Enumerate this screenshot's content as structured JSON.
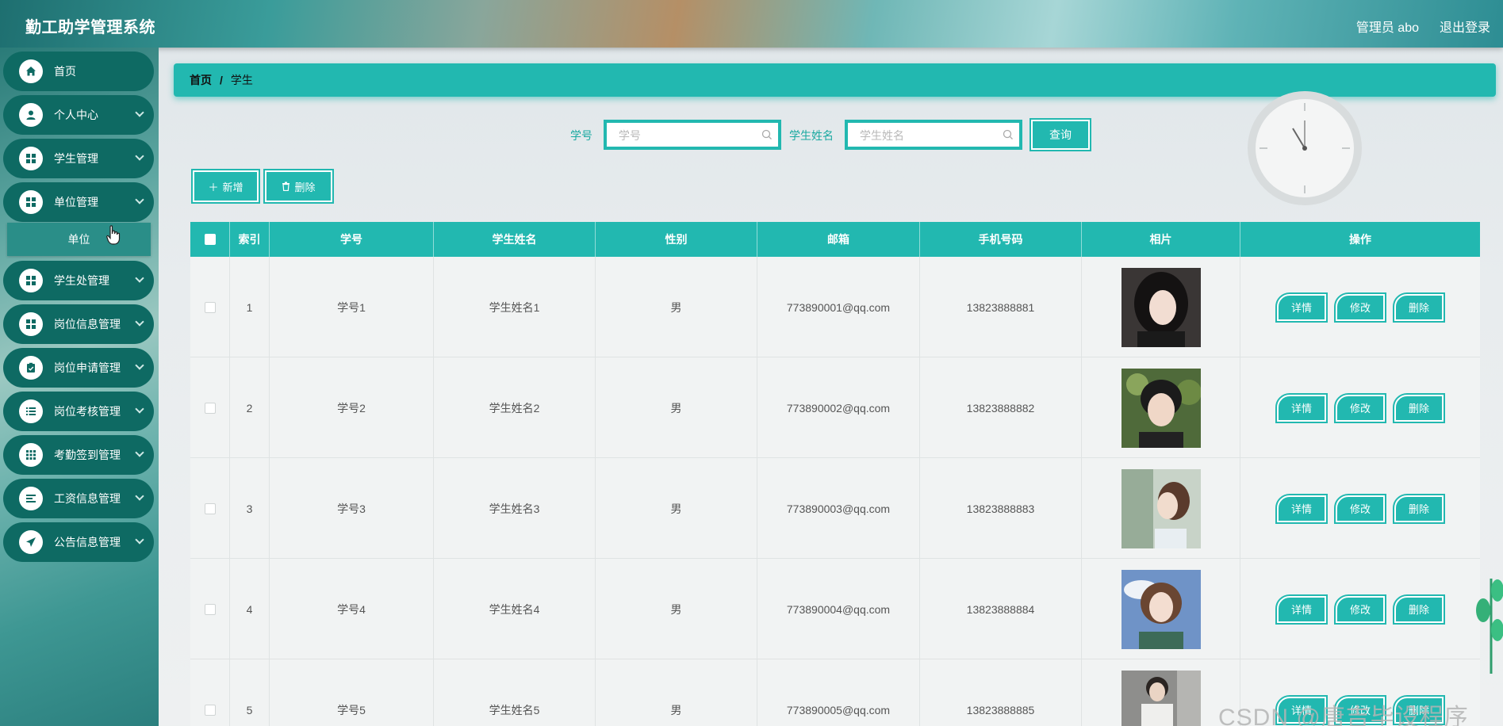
{
  "app": {
    "title": "勤工助学管理系统"
  },
  "header": {
    "user_label": "管理员 abo",
    "logout_label": "退出登录"
  },
  "sidebar": {
    "items": [
      {
        "label": "首页",
        "icon": "home-icon",
        "has_arrow": false
      },
      {
        "label": "个人中心",
        "icon": "user-icon",
        "has_arrow": true
      },
      {
        "label": "学生管理",
        "icon": "grid-icon",
        "has_arrow": true
      },
      {
        "label": "单位管理",
        "icon": "grid-icon",
        "has_arrow": true
      },
      {
        "label": "学生处管理",
        "icon": "grid-icon",
        "has_arrow": true
      },
      {
        "label": "岗位信息管理",
        "icon": "grid-icon",
        "has_arrow": true
      },
      {
        "label": "岗位申请管理",
        "icon": "clipboard-icon",
        "has_arrow": true
      },
      {
        "label": "岗位考核管理",
        "icon": "list-icon",
        "has_arrow": true
      },
      {
        "label": "考勤签到管理",
        "icon": "apps-icon",
        "has_arrow": true
      },
      {
        "label": "工资信息管理",
        "icon": "align-icon",
        "has_arrow": true
      },
      {
        "label": "公告信息管理",
        "icon": "send-icon",
        "has_arrow": true
      }
    ],
    "submenu_label": "单位"
  },
  "breadcrumb": {
    "home": "首页",
    "separator": "/",
    "current": "学生"
  },
  "search": {
    "student_no_label": "学号",
    "student_no_placeholder": "学号",
    "student_name_label": "学生姓名",
    "student_name_placeholder": "学生姓名",
    "query_label": "查询"
  },
  "actions": {
    "add_label": "新增",
    "delete_label": "删除"
  },
  "table": {
    "columns": [
      "索引",
      "学号",
      "学生姓名",
      "性别",
      "邮箱",
      "手机号码",
      "相片",
      "操作"
    ],
    "row_actions": {
      "detail": "详情",
      "edit": "修改",
      "delete": "删除"
    },
    "rows": [
      {
        "index": "1",
        "student_no": "学号1",
        "name": "学生姓名1",
        "gender": "男",
        "email": "773890001@qq.com",
        "phone": "13823888881"
      },
      {
        "index": "2",
        "student_no": "学号2",
        "name": "学生姓名2",
        "gender": "男",
        "email": "773890002@qq.com",
        "phone": "13823888882"
      },
      {
        "index": "3",
        "student_no": "学号3",
        "name": "学生姓名3",
        "gender": "男",
        "email": "773890003@qq.com",
        "phone": "13823888883"
      },
      {
        "index": "4",
        "student_no": "学号4",
        "name": "学生姓名4",
        "gender": "男",
        "email": "773890004@qq.com",
        "phone": "13823888884"
      },
      {
        "index": "5",
        "student_no": "学号5",
        "name": "学生姓名5",
        "gender": "男",
        "email": "773890005@qq.com",
        "phone": "13823888885"
      }
    ]
  },
  "watermark": "CSDN @唐吉毕设程序",
  "colors": {
    "accent": "#22b8b0",
    "menu_bg": "#0e6a63",
    "submenu_bg": "#2a8e88"
  }
}
